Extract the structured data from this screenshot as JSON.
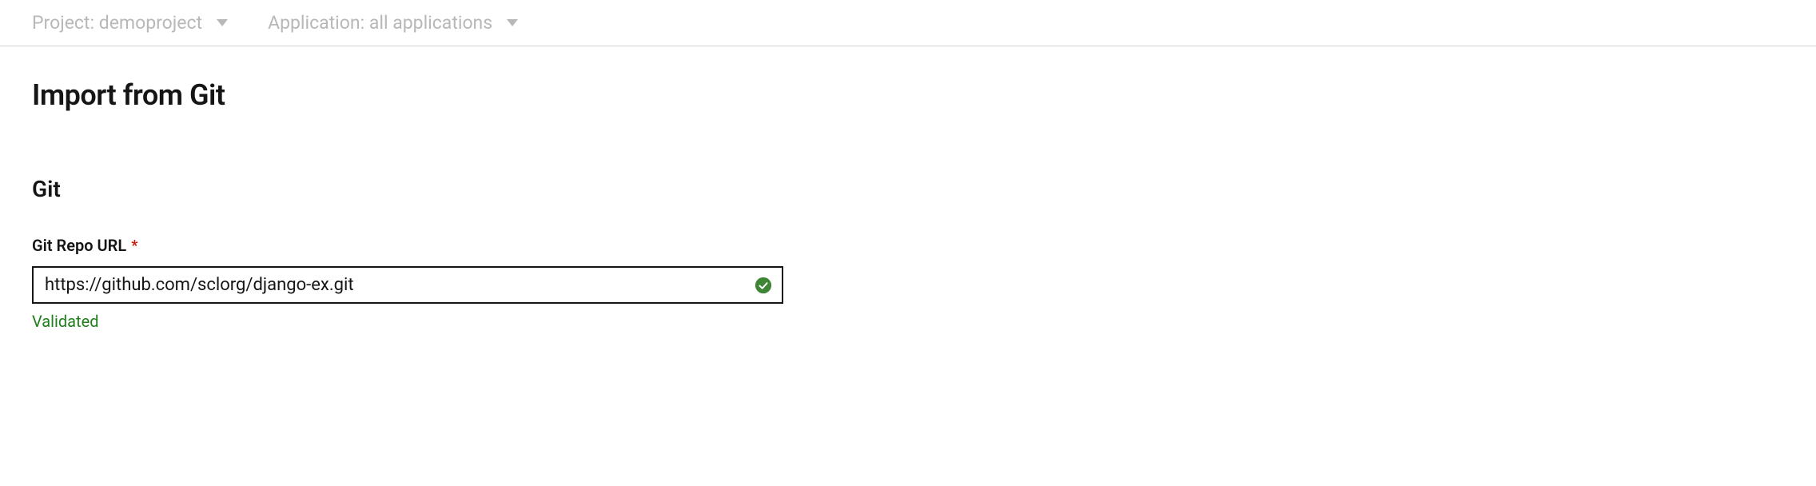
{
  "topbar": {
    "project": {
      "label": "Project: demoproject"
    },
    "application": {
      "label": "Application: all applications"
    }
  },
  "page": {
    "title": "Import from Git"
  },
  "section": {
    "title": "Git"
  },
  "form": {
    "gitRepoUrl": {
      "label": "Git Repo URL",
      "required": "*",
      "value": "https://github.com/sclorg/django-ex.git",
      "validation": "Validated"
    }
  },
  "colors": {
    "success": "#3e8635",
    "required": "#c9190b"
  }
}
